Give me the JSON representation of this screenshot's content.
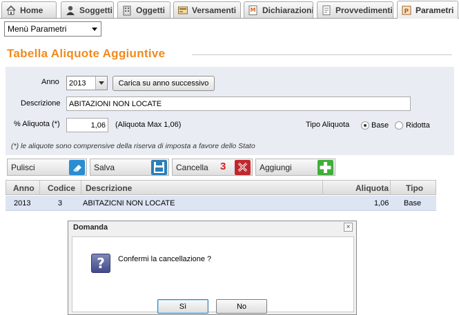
{
  "tabs": [
    {
      "label": "Home",
      "icon": "home-icon"
    },
    {
      "label": "Soggetti",
      "icon": "person-icon"
    },
    {
      "label": "Oggetti",
      "icon": "building-icon"
    },
    {
      "label": "Versamenti",
      "icon": "payment-icon"
    },
    {
      "label": "Dichiarazioni",
      "icon": "declaration-icon"
    },
    {
      "label": "Provvedimenti",
      "icon": "document-icon"
    },
    {
      "label": "Parametri",
      "icon": "parameters-icon"
    }
  ],
  "menu_select": {
    "value": "Menù Parametri"
  },
  "page_title": "Tabella Aliquote Aggiuntive",
  "form": {
    "anno_label": "Anno",
    "anno_value": "2013",
    "load_next_label": "Carica su anno successivo",
    "descrizione_label": "Descrizione",
    "descrizione_value": "ABITAZIONI NON LOCATE",
    "aliquota_label": "% Aliquota (*)",
    "aliquota_value": "1,06",
    "aliquota_max": "(Aliquota Max 1,06)",
    "tipo_label": "Tipo Aliquota",
    "tipo_options": [
      {
        "label": "Base",
        "selected": true
      },
      {
        "label": "Ridotta",
        "selected": false
      }
    ],
    "note": "(*) le aliquote sono comprensive della riserva di imposta a favore dello Stato"
  },
  "actions": {
    "pulisci": "Pulisci",
    "salva": "Salva",
    "cancella": "Cancella",
    "step_number": "3",
    "aggiungi": "Aggiungi"
  },
  "table": {
    "headers": [
      "Anno",
      "Codice",
      "Descrizione",
      "Aliquota",
      "Tipo"
    ],
    "rows": [
      [
        "2013",
        "3",
        "ABITAZICNI NON LOCATE",
        "1,06",
        "Base"
      ]
    ]
  },
  "dialog": {
    "title": "Domanda",
    "close_glyph": "×",
    "icon": "question-icon",
    "icon_glyph": "?",
    "message": "Confermi la cancellazione ?",
    "yes_label": "Sì",
    "no_label": "No"
  },
  "colors": {
    "title_orange": "#f08a1e",
    "panel_bg": "#e9edf3",
    "selected_row": "#dde5f3",
    "step_red": "#d81c1c"
  }
}
